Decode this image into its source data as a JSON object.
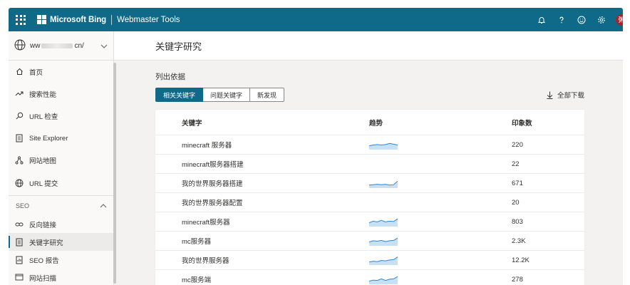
{
  "header": {
    "brand": "Microsoft Bing",
    "product": "Webmaster Tools",
    "avatar_initial": "粥",
    "icons": [
      "bell-icon",
      "help-icon",
      "smiley-icon",
      "gear-icon"
    ],
    "accent_color": "#0f6a8a"
  },
  "sidebar": {
    "site_prefix": "ww",
    "site_suffix": "cn/",
    "items": [
      {
        "label": "首页",
        "icon": "home-icon"
      },
      {
        "label": "搜索性能",
        "icon": "trend-icon"
      },
      {
        "label": "URL 检查",
        "icon": "search-icon"
      },
      {
        "label": "Site Explorer",
        "icon": "document-icon"
      },
      {
        "label": "网站地图",
        "icon": "sitemap-icon"
      },
      {
        "label": "URL 提交",
        "icon": "globe-icon"
      }
    ],
    "section_label": "SEO",
    "seo_items": [
      {
        "label": "反向链接",
        "icon": "link-icon"
      },
      {
        "label": "关键字研究",
        "icon": "document-icon",
        "active": true
      },
      {
        "label": "SEO 报告",
        "icon": "report-icon"
      },
      {
        "label": "网站扫描",
        "icon": "scan-icon"
      }
    ]
  },
  "main": {
    "title": "关键字研究",
    "list_label": "列出依据",
    "tabs": [
      "相关关键字",
      "问题关键字",
      "新发现"
    ],
    "download_label": "全部下载",
    "columns": [
      "关键字",
      "趋势",
      "印象数"
    ],
    "rows": [
      {
        "keyword": "minecraft 服务器",
        "impressions": "220",
        "trend": [
          0.4,
          0.5,
          0.55,
          0.5,
          0.55,
          0.7,
          0.6,
          0.5
        ]
      },
      {
        "keyword": "minecraft服务器搭建",
        "impressions": "22",
        "trend": null
      },
      {
        "keyword": "我的世界服务器搭建",
        "impressions": "671",
        "trend": [
          0.3,
          0.35,
          0.4,
          0.35,
          0.4,
          0.3,
          0.35,
          0.8
        ]
      },
      {
        "keyword": "我的世界服务器配置",
        "impressions": "20",
        "trend": null
      },
      {
        "keyword": "minecraft服务器",
        "impressions": "803",
        "trend": [
          0.4,
          0.6,
          0.5,
          0.7,
          0.5,
          0.6,
          0.55,
          0.9
        ]
      },
      {
        "keyword": "mc服务器",
        "impressions": "2.3K",
        "trend": [
          0.4,
          0.55,
          0.5,
          0.6,
          0.45,
          0.55,
          0.6,
          0.9
        ]
      },
      {
        "keyword": "我的世界服务器",
        "impressions": "12.2K",
        "trend": [
          0.3,
          0.4,
          0.35,
          0.5,
          0.45,
          0.55,
          0.6,
          0.95
        ]
      },
      {
        "keyword": "mc服务端",
        "impressions": "278",
        "trend": [
          0.3,
          0.45,
          0.4,
          0.6,
          0.4,
          0.55,
          0.6,
          0.9
        ]
      }
    ]
  }
}
